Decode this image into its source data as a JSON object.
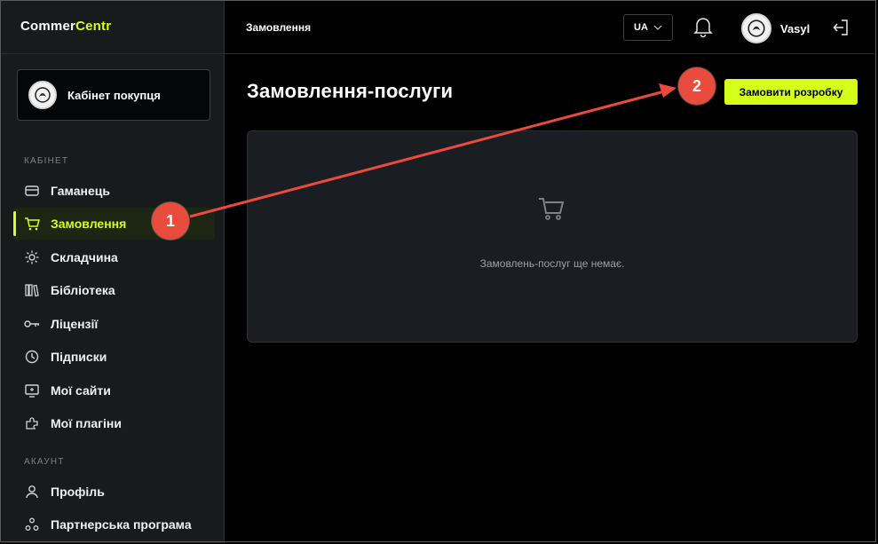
{
  "app": {
    "logo_part1": "Commer",
    "logo_part2": "Centr"
  },
  "sidebar": {
    "cabinet_label": "Кабінет покупця",
    "section_cabinet": "КАБІНЕТ",
    "items": [
      {
        "label": "Гаманець",
        "icon": "wallet-icon"
      },
      {
        "label": "Замовлення",
        "icon": "cart-icon",
        "active": true
      },
      {
        "label": "Складчина",
        "icon": "sun-icon"
      },
      {
        "label": "Бібліотека",
        "icon": "library-icon"
      },
      {
        "label": "Ліцензії",
        "icon": "key-icon"
      },
      {
        "label": "Підписки",
        "icon": "clock-icon"
      },
      {
        "label": "Мої сайти",
        "icon": "monitor-icon"
      },
      {
        "label": "Мої плагіни",
        "icon": "puzzle-icon"
      }
    ],
    "section_account": "АКАУНТ",
    "account_items": [
      {
        "label": "Профіль",
        "icon": "user-icon"
      },
      {
        "label": "Партнерська програма",
        "icon": "partners-icon"
      }
    ]
  },
  "header": {
    "breadcrumb": "Замовлення",
    "language": "UA",
    "user_name": "Vasyl"
  },
  "main": {
    "title": "Замовлення-послуги",
    "order_button": "Замовити розробку",
    "empty_message": "Замовлень-послуг ще немає."
  },
  "annotations": [
    {
      "label": "1"
    },
    {
      "label": "2"
    }
  ],
  "colors": {
    "accent": "#d4ff1a",
    "annotation": "#e94b3c",
    "sidebar_bg": "#171b1c",
    "card_bg": "#1a1e22"
  }
}
